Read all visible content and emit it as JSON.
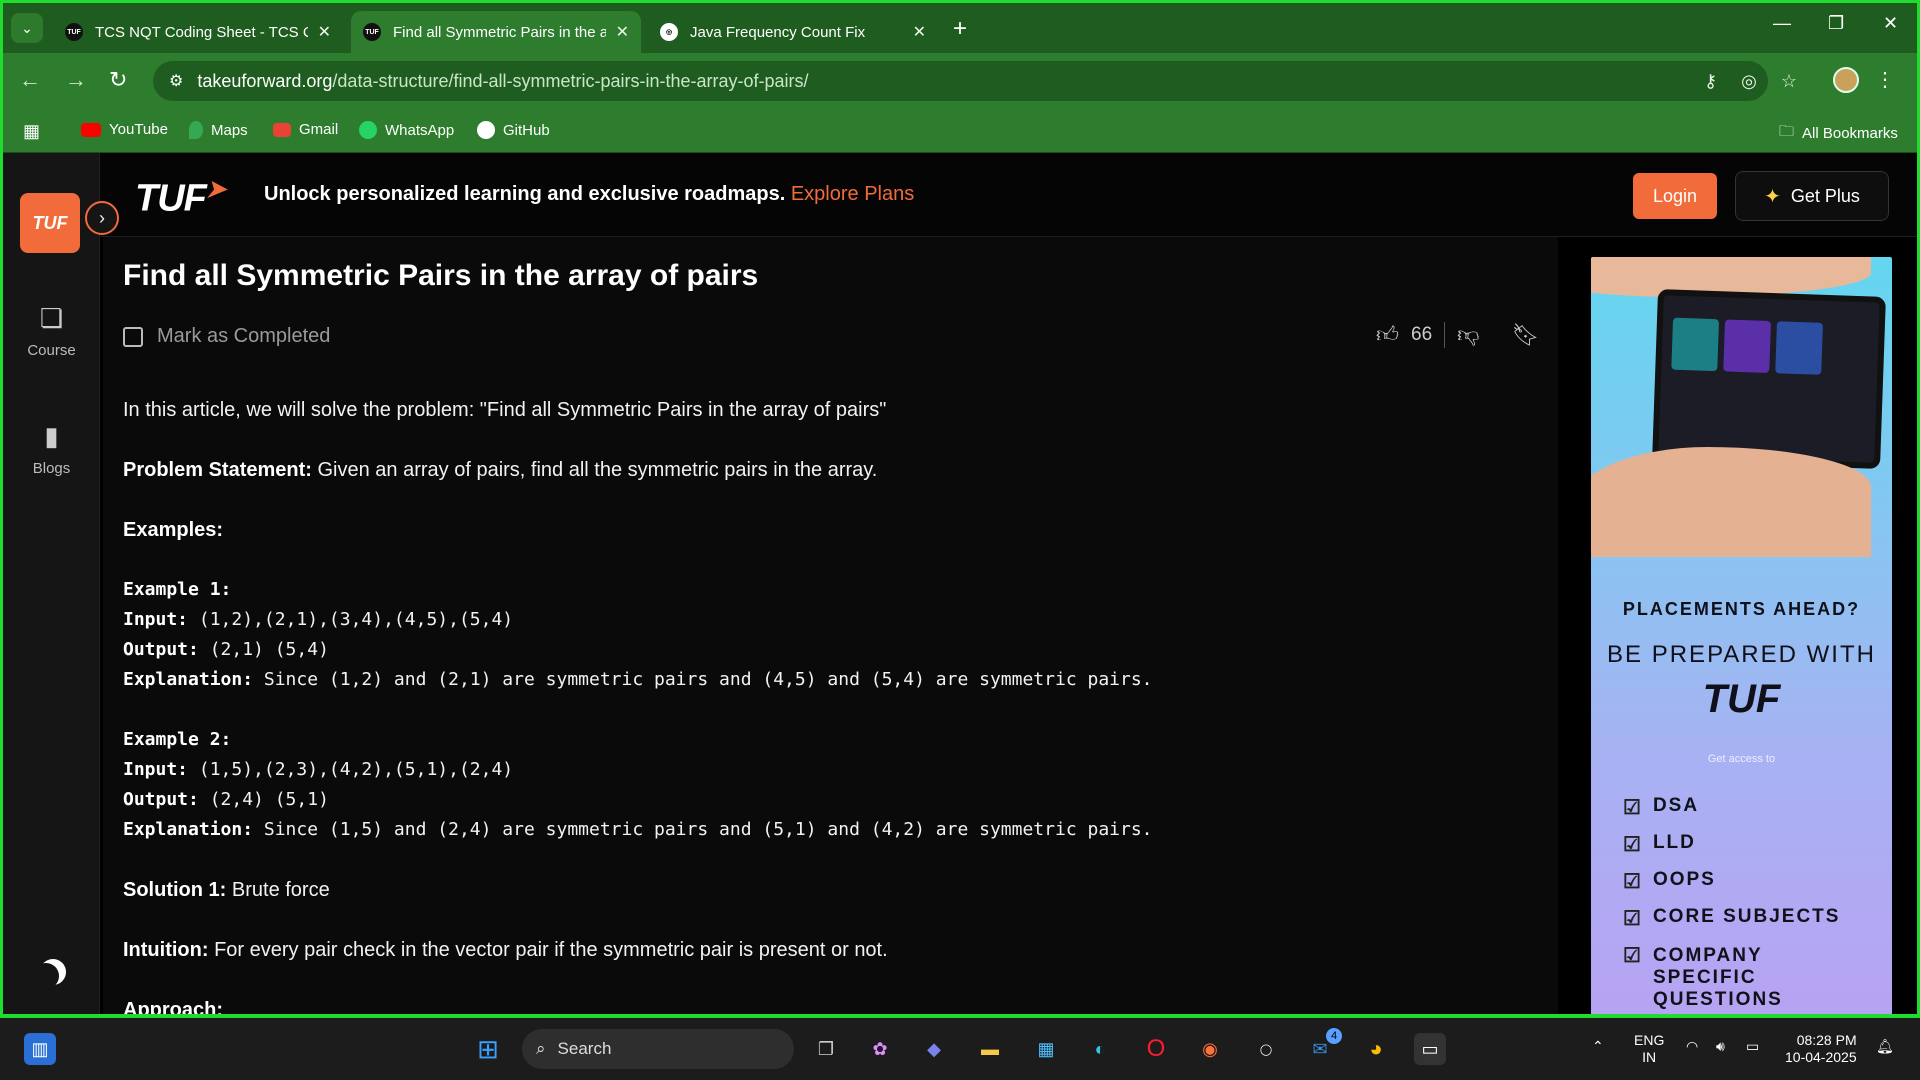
{
  "browser": {
    "tabs": [
      {
        "title": "TCS NQT Coding Sheet - TCS Coding",
        "favicon": "TUF",
        "active": false
      },
      {
        "title": "Find all Symmetric Pairs in the array",
        "favicon": "TUF",
        "active": true
      },
      {
        "title": "Java Frequency Count Fix",
        "favicon": "chatgpt-icon",
        "active": false
      }
    ],
    "url_host": "takeuforward.org",
    "url_path": "/data-structure/find-all-symmetric-pairs-in-the-array-of-pairs/",
    "bookmarks": [
      "YouTube",
      "Maps",
      "Gmail",
      "WhatsApp",
      "GitHub"
    ],
    "all_bookmarks": "All Bookmarks"
  },
  "sidebar": {
    "logo": "TUF",
    "items": [
      {
        "label": "Course",
        "icon": "course-icon"
      },
      {
        "label": "Blogs",
        "icon": "blogs-icon"
      }
    ]
  },
  "topnav": {
    "brand": "TUF",
    "promo_text": "Unlock personalized learning and exclusive roadmaps.",
    "promo_link": "Explore Plans",
    "login": "Login",
    "get_plus": "Get Plus"
  },
  "article": {
    "title": "Find all Symmetric Pairs in the array of pairs",
    "mark_completed": "Mark as Completed",
    "likes": "66",
    "intro": "In this article, we will solve the problem: \"Find all Symmetric Pairs in the array of pairs\"",
    "problem_label": "Problem Statement:",
    "problem_text": " Given an array of pairs, find all the symmetric pairs in the array.",
    "examples_label": "Examples:",
    "ex1_title": "Example 1:",
    "ex1_input_label": "Input:",
    "ex1_input": " (1,2),(2,1),(3,4),(4,5),(5,4)",
    "ex1_output_label": "Output:",
    "ex1_output": " (2,1) (5,4)",
    "ex1_expl_label": "Explanation:",
    "ex1_expl": " Since (1,2) and (2,1) are symmetric pairs and (4,5) and (5,4) are symmetric pairs.",
    "ex2_title": "Example 2:",
    "ex2_input_label": "Input:",
    "ex2_input": " (1,5),(2,3),(4,2),(5,1),(2,4)",
    "ex2_output_label": "Output:",
    "ex2_output": " (2,4) (5,1)",
    "ex2_expl_label": "Explanation:",
    "ex2_expl": " Since (1,5) and (2,4) are symmetric pairs and (5,1) and (4,2) are symmetric pairs.",
    "solution_label": "Solution 1:",
    "solution_text": " Brute force",
    "intuition_label": "Intuition:",
    "intuition_text": " For every pair check in the vector pair if the symmetric pair is present or not.",
    "approach_label": "Approach:"
  },
  "ad": {
    "headline": "PLACEMENTS AHEAD?",
    "sub": "BE PREPARED WITH",
    "brand": "TUF",
    "access": "Get access to",
    "features": [
      "DSA",
      "LLD",
      "OOPS",
      "CORE SUBJECTS",
      "COMPANY SPECIFIC QUESTIONS"
    ]
  },
  "taskbar": {
    "search_placeholder": "Search",
    "lang": "ENG",
    "region": "IN",
    "time": "08:28 PM",
    "date": "10-04-2025",
    "store_badge": "4"
  }
}
